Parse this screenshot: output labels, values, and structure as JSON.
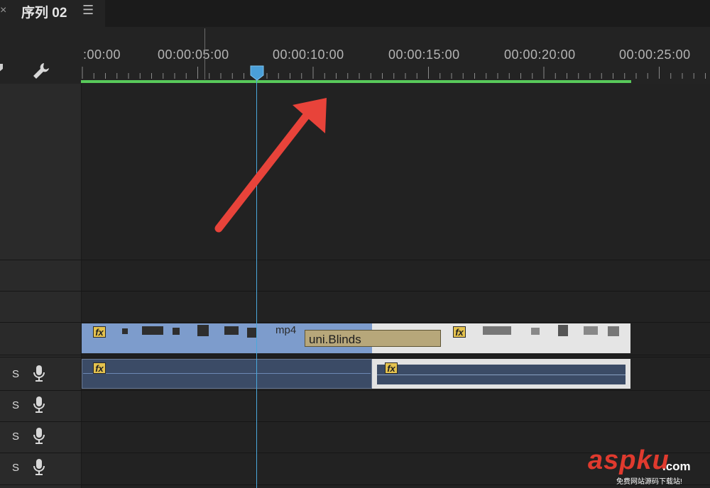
{
  "tab": {
    "title": "序列 02",
    "close_glyph": "×",
    "menu_glyph": "☰"
  },
  "ruler": {
    "labels": [
      ":00:00",
      "00:00:05:00",
      "00:00:10:00",
      "00:00:15:00",
      "00:00:20:00",
      "00:00:25:00"
    ]
  },
  "tracks": {
    "audio_solo_label": "S"
  },
  "clips": {
    "video1_name": "mp4",
    "transition_label": "uni.Blinds",
    "fx_label": "fx"
  },
  "colors": {
    "work_area": "#58c95a",
    "playhead": "#4aa8dc",
    "annotation_arrow": "#e8433a",
    "video_clip": "#7d9ccc",
    "fx_badge": "#e4c24e"
  },
  "icons": [
    "marker-icon",
    "wrench-icon",
    "microphone-icon",
    "playhead-icon",
    "annotation-arrow-icon"
  ],
  "watermark": {
    "brand": "aspku",
    "suffix": ".com",
    "tagline": "免费网站源码下载站!"
  }
}
